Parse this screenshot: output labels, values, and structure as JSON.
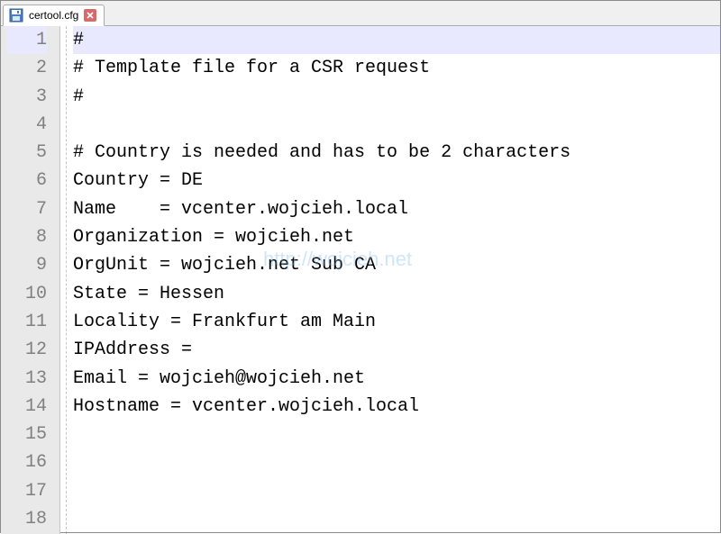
{
  "tab": {
    "filename": "certool.cfg"
  },
  "editor": {
    "line_count": 18,
    "highlighted_line": 1,
    "lines": {
      "l1": "#",
      "l2": "# Template file for a CSR request",
      "l3": "#",
      "l4": "",
      "l5": "# Country is needed and has to be 2 characters",
      "l6": "Country = DE",
      "l7": "Name    = vcenter.wojcieh.local",
      "l8": "Organization = wojcieh.net",
      "l9": "OrgUnit = wojcieh.net Sub CA",
      "l10": "State = Hessen",
      "l11": "Locality = Frankfurt am Main",
      "l12": "IPAddress =",
      "l13": "Email = wojcieh@wojcieh.net",
      "l14": "Hostname = vcenter.wojcieh.local",
      "l15": "",
      "l16": "",
      "l17": "",
      "l18": ""
    }
  },
  "gutter": {
    "n1": "1",
    "n2": "2",
    "n3": "3",
    "n4": "4",
    "n5": "5",
    "n6": "6",
    "n7": "7",
    "n8": "8",
    "n9": "9",
    "n10": "10",
    "n11": "11",
    "n12": "12",
    "n13": "13",
    "n14": "14",
    "n15": "15",
    "n16": "16",
    "n17": "17",
    "n18": "18"
  },
  "watermark": "http://wojcieh.net"
}
